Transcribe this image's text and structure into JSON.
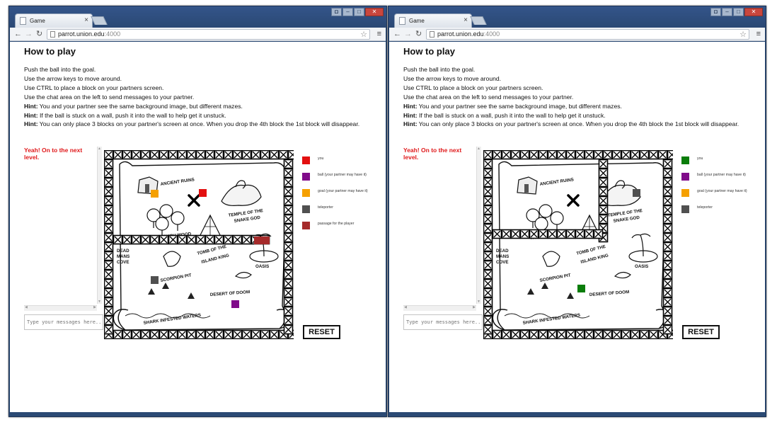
{
  "windows": [
    {
      "tab_title": "Game",
      "url_host": "parrot.union.edu",
      "url_port": ":4000",
      "heading": "How to play",
      "chat_message": "Yeah! On to the next level.",
      "chat_placeholder": "Type your messages here...",
      "reset_label": "RESET",
      "legend": [
        {
          "label": "you",
          "color": "#e31010"
        },
        {
          "label": "ball (your partner may have it)",
          "color": "#800b8a"
        },
        {
          "label": "goal (your partner may have it)",
          "color": "#f5a000"
        },
        {
          "label": "teleporter",
          "color": "#505050"
        },
        {
          "label": "passage for the player",
          "color": "#a52a2a"
        }
      ]
    },
    {
      "tab_title": "Game",
      "url_host": "parrot.union.edu",
      "url_port": ":4000",
      "heading": "How to play",
      "chat_message": "Yeah! On to the next level.",
      "chat_placeholder": "Type your messages here...",
      "reset_label": "RESET",
      "legend": [
        {
          "label": "you",
          "color": "#0a7d0a"
        },
        {
          "label": "ball (your partner may have it)",
          "color": "#800b8a"
        },
        {
          "label": "goal (your partner may have it)",
          "color": "#f5a000"
        },
        {
          "label": "teleporter",
          "color": "#505050"
        }
      ]
    }
  ],
  "instructions": {
    "line1": "Push the ball into the goal.",
    "line2": "Use the arrow keys to move around.",
    "line3": "Use CTRL to place a block on your partners screen.",
    "line4": "Use the chat area on the left to send messages to your partner.",
    "hint_label": "Hint:",
    "hint1": " You and your partner see the same background image, but different mazes.",
    "hint2": " If the ball is stuck on a wall, push it into the wall to help get it unstuck.",
    "hint3": " You can only place 3 blocks on your partner's screen at once. When you drop the 4th block the 1st block will disappear."
  },
  "map": {
    "labels": {
      "ruins": "ANCIENT RUINS",
      "touchwood": "THE TOUCH WOOD",
      "temple1": "TEMPLE OF THE",
      "temple2": "SNAKE GOD",
      "dead1": "DEAD",
      "dead2": "MANS",
      "dead3": "COVE",
      "tomb1": "TOMB OF THE",
      "tomb2": "ISLAND KING",
      "oasis": "OASIS",
      "scorpion": "SCORPION PIT",
      "desert": "DESERT OF DOOM",
      "shark": "SHARK INFESTED WATERS",
      "signature": "Chris Allen"
    }
  }
}
